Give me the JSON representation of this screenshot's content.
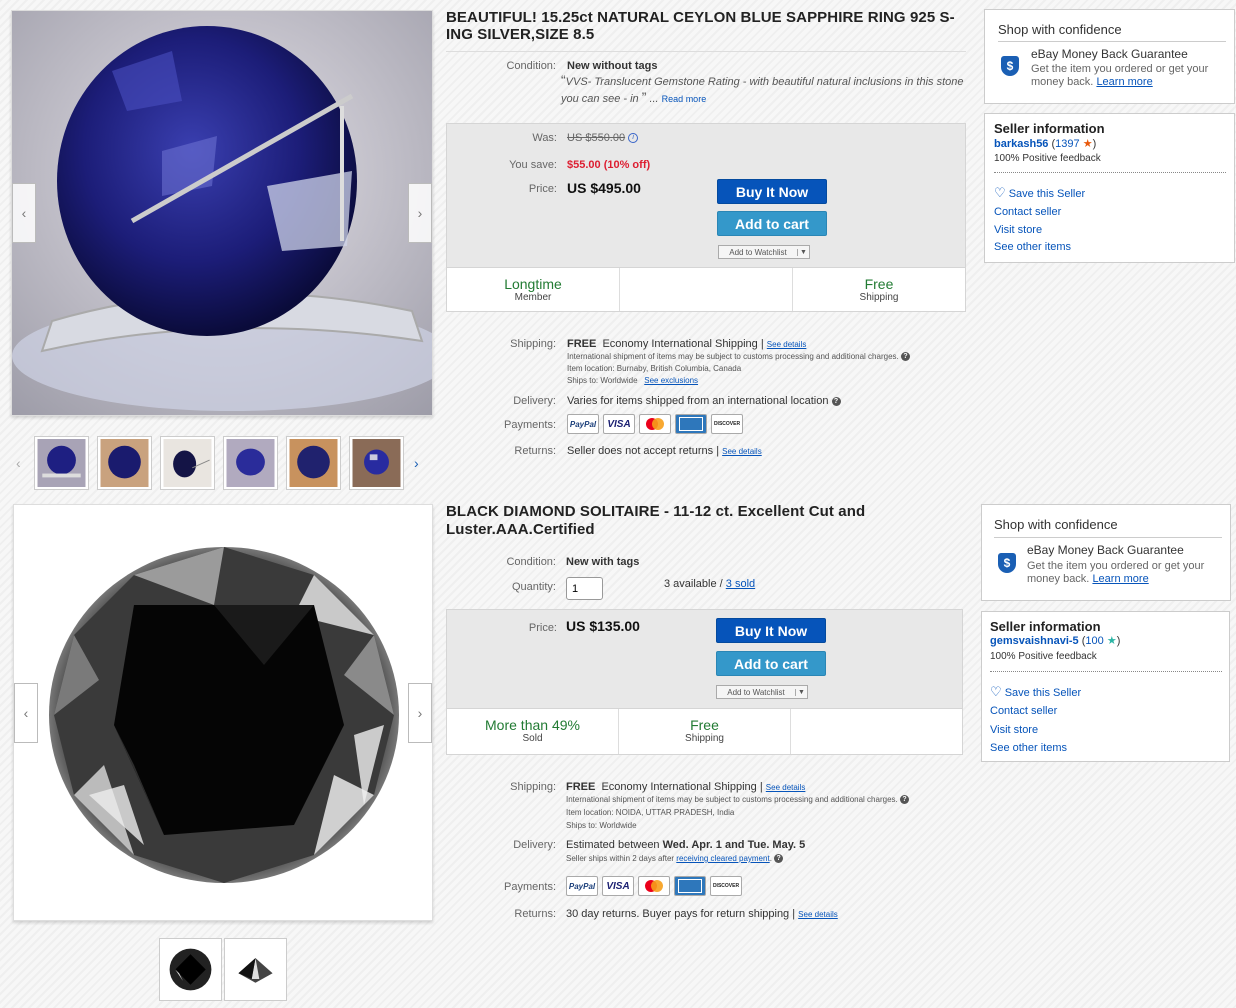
{
  "listing1": {
    "title": "BEAUTIFUL! 15.25ct NATURAL CEYLON BLUE SAPPHIRE RING 925 S-ING SILVER,SIZE 8.5",
    "condition_label": "Condition:",
    "condition_value": "New without tags",
    "condition_desc": "VVS- Translucent Gemstone Rating - with beautiful natural inclusions in this stone you can see - in",
    "read_more": "Read more",
    "was_label": "Was:",
    "was_value": "US $550.00",
    "save_label": "You save:",
    "save_value": "$55.00 (10% off)",
    "price_label": "Price:",
    "price_value": "US $495.00",
    "buy_now": "Buy It Now",
    "add_to_cart": "Add to cart",
    "watchlist": "Add to Watchlist",
    "stats": [
      {
        "big": "Longtime",
        "small": "Member"
      },
      {
        "big": "",
        "small": ""
      },
      {
        "big": "Free",
        "small": "Shipping"
      }
    ],
    "shipping_label": "Shipping:",
    "shipping_free": "FREE",
    "shipping_method": "Economy International Shipping",
    "see_details": "See details",
    "customs_note": "International shipment of items may be subject to customs processing and additional charges.",
    "item_location": "Item location:  Burnaby, British Columbia, Canada",
    "ships_to": "Ships to:  Worldwide",
    "see_exclusions": "See exclusions",
    "delivery_label": "Delivery:",
    "delivery_value": "Varies for items shipped from an international location",
    "payments_label": "Payments:",
    "returns_label": "Returns:",
    "returns_value": "Seller does not accept returns",
    "returns_details": "See details",
    "confidence": {
      "head": "Shop with confidence",
      "guarantee": "eBay Money Back Guarantee",
      "desc": "Get the item you ordered or get your money back.",
      "learn": "Learn more"
    },
    "seller": {
      "head": "Seller information",
      "name": "barkash56",
      "score": "1397",
      "feedback": "100% Positive feedback",
      "save": "Save this Seller",
      "contact": "Contact seller",
      "store": "Visit store",
      "other": "See other items"
    }
  },
  "listing2": {
    "title": "BLACK DIAMOND SOLITAIRE - 11-12 ct. Excellent Cut and Luster.AAA.Certified",
    "condition_label": "Condition:",
    "condition_value": "New with tags",
    "quantity_label": "Quantity:",
    "quantity_value": "1",
    "available": "3 available /",
    "sold": "3 sold",
    "price_label": "Price:",
    "price_value": "US $135.00",
    "buy_now": "Buy It Now",
    "add_to_cart": "Add to cart",
    "watchlist": "Add to Watchlist",
    "stats": [
      {
        "big": "More than 49%",
        "small": "Sold"
      },
      {
        "big": "Free",
        "small": "Shipping"
      },
      {
        "big": "",
        "small": ""
      }
    ],
    "shipping_label": "Shipping:",
    "shipping_free": "FREE",
    "shipping_method": "Economy International Shipping",
    "see_details": "See details",
    "customs_note": "International shipment of items may be subject to customs processing and additional charges.",
    "item_location": "Item location:  NOIDA, UTTAR PRADESH, India",
    "ships_to": "Ships to:  Worldwide",
    "delivery_label": "Delivery:",
    "delivery_prefix": "Estimated between",
    "delivery_dates": "Wed. Apr. 1 and Tue. May. 5",
    "delivery_note": "Seller ships within 2 days after",
    "delivery_link": "receiving cleared payment",
    "payments_label": "Payments:",
    "returns_label": "Returns:",
    "returns_value": "30 day returns. Buyer pays for return shipping",
    "returns_details": "See details",
    "confidence": {
      "head": "Shop with confidence",
      "guarantee": "eBay Money Back Guarantee",
      "desc": "Get the item you ordered or get your money back.",
      "learn": "Learn more"
    },
    "seller": {
      "head": "Seller information",
      "name": "gemsvaishnavi-5",
      "score": "100",
      "feedback": "100% Positive feedback",
      "save": "Save this Seller",
      "contact": "Contact seller",
      "store": "Visit store",
      "other": "See other items"
    }
  },
  "payment_methods": [
    "PayPal",
    "VISA",
    "MasterCard",
    "American Express",
    "DISCOVER"
  ],
  "colors": {
    "link": "#0654ba",
    "buy": "#0654ba",
    "cart": "#3498ca",
    "green": "#227b33",
    "red": "#dd1e31"
  }
}
